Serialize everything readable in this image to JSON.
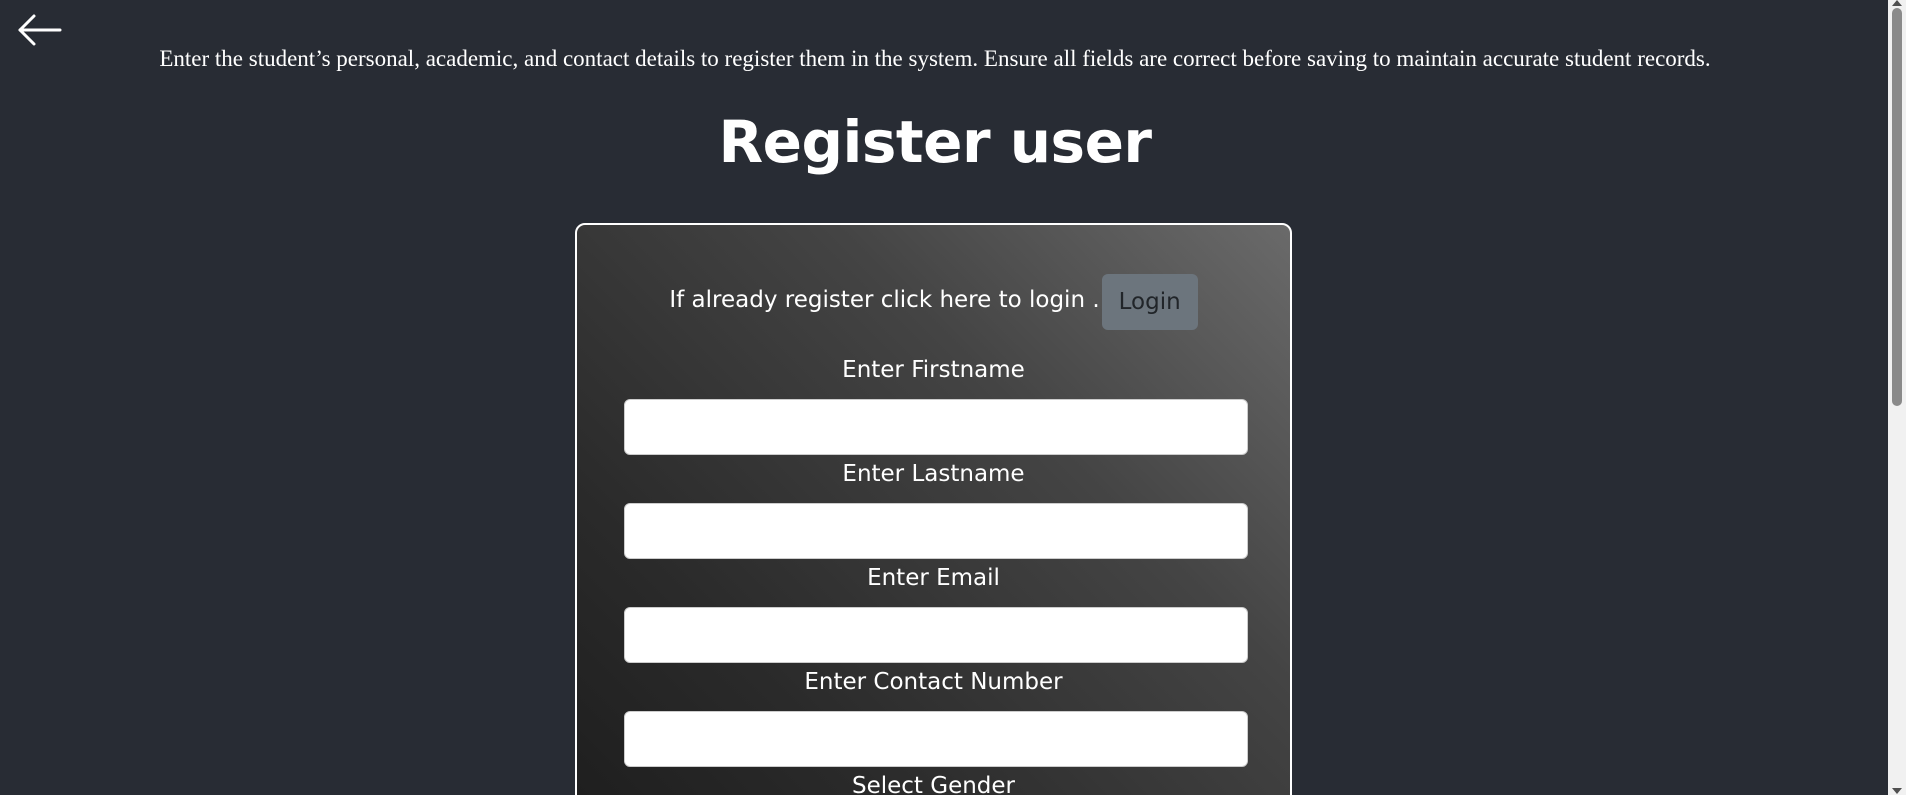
{
  "page": {
    "intro_text": "Enter the student’s personal, academic, and contact details to register them in the system. Ensure all fields are correct before saving to maintain accurate student records.",
    "title": "Register user"
  },
  "login_prompt": {
    "text": "If already register click here to login .",
    "button_label": "Login"
  },
  "form": {
    "fields": [
      {
        "label": "Enter Firstname",
        "value": ""
      },
      {
        "label": "Enter Lastname",
        "value": ""
      },
      {
        "label": "Enter Email",
        "value": ""
      },
      {
        "label": "Enter Contact Number",
        "value": ""
      }
    ],
    "gender_label": "Select Gender"
  },
  "icons": {
    "back": "arrow-left-icon"
  },
  "colors": {
    "background": "#282c34",
    "login_button": "#6c757d",
    "text": "#ffffff"
  }
}
